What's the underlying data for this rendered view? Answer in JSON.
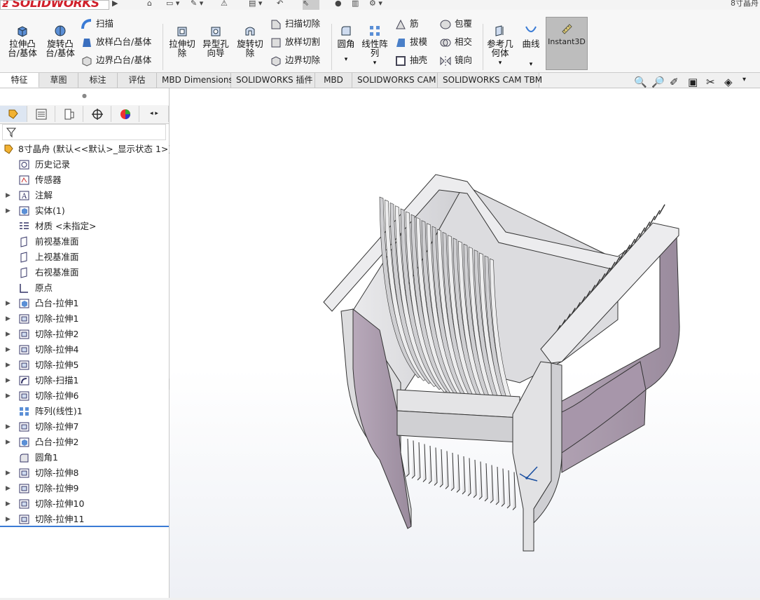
{
  "app": {
    "logo_text": "SOLIDWORKS",
    "title_fragment": "8寸晶舟"
  },
  "ribbon": {
    "buttons": [
      {
        "id": "extrude_boss",
        "label": "拉伸凸台/基体",
        "icon": "extrude-boss-icon"
      },
      {
        "id": "revolve_boss",
        "label": "旋转凸台/基体",
        "icon": "revolve-boss-icon"
      },
      {
        "id": "extrude_cut",
        "label": "拉伸切除",
        "icon": "extrude-cut-icon"
      },
      {
        "id": "hole_wizard",
        "label": "异型孔向导",
        "icon": "hole-wizard-icon"
      },
      {
        "id": "revolve_cut",
        "label": "旋转切除",
        "icon": "revolve-cut-icon"
      },
      {
        "id": "fillet",
        "label": "圆角",
        "icon": "fillet-icon"
      },
      {
        "id": "linear_pattern",
        "label": "线性阵列",
        "icon": "linear-pattern-icon"
      },
      {
        "id": "ref_geometry",
        "label": "参考几何体",
        "icon": "reference-geometry-icon"
      },
      {
        "id": "curves",
        "label": "曲线",
        "icon": "curves-icon"
      },
      {
        "id": "instant3d",
        "label": "Instant3D",
        "icon": "instant3d-icon"
      }
    ],
    "small": {
      "sweep": "扫描",
      "loft": "放样凸台/基体",
      "boundary": "边界凸台/基体",
      "sweep_cut": "扫描切除",
      "loft_cut": "放样切割",
      "boundary_cut": "边界切除",
      "rib": "筋",
      "draft": "拔模",
      "shell": "抽壳",
      "wrap": "包覆",
      "intersect": "相交",
      "mirror": "镜向"
    }
  },
  "tabs": [
    "特征",
    "草图",
    "标注",
    "评估",
    "MBD Dimensions",
    "SOLIDWORKS 插件",
    "MBD",
    "SOLIDWORKS CAM",
    "SOLIDWORKS CAM TBM"
  ],
  "active_tab": "特征",
  "tree": {
    "root": "8寸晶舟  (默认<<默认>_显示状态 1>)",
    "items": [
      {
        "label": "历史记录",
        "icon": "history-icon",
        "expand": false
      },
      {
        "label": "传感器",
        "icon": "sensor-icon",
        "expand": false
      },
      {
        "label": "注解",
        "icon": "annotation-icon",
        "expand": true
      },
      {
        "label": "实体(1)",
        "icon": "solid-bodies-icon",
        "expand": true
      },
      {
        "label": "材质 <未指定>",
        "icon": "material-icon",
        "expand": false
      },
      {
        "label": "前视基准面",
        "icon": "plane-icon",
        "expand": false
      },
      {
        "label": "上视基准面",
        "icon": "plane-icon",
        "expand": false
      },
      {
        "label": "右视基准面",
        "icon": "plane-icon",
        "expand": false
      },
      {
        "label": "原点",
        "icon": "origin-icon",
        "expand": false
      },
      {
        "label": "凸台-拉伸1",
        "icon": "boss-extrude-icon",
        "expand": true
      },
      {
        "label": "切除-拉伸1",
        "icon": "cut-extrude-icon",
        "expand": true
      },
      {
        "label": "切除-拉伸2",
        "icon": "cut-extrude-icon",
        "expand": true
      },
      {
        "label": "切除-拉伸4",
        "icon": "cut-extrude-icon",
        "expand": true
      },
      {
        "label": "切除-拉伸5",
        "icon": "cut-extrude-icon",
        "expand": true
      },
      {
        "label": "切除-扫描1",
        "icon": "cut-sweep-icon",
        "expand": true
      },
      {
        "label": "切除-拉伸6",
        "icon": "cut-extrude-icon",
        "expand": true
      },
      {
        "label": "阵列(线性)1",
        "icon": "linear-pattern-icon",
        "expand": false
      },
      {
        "label": "切除-拉伸7",
        "icon": "cut-extrude-icon",
        "expand": true
      },
      {
        "label": "凸台-拉伸2",
        "icon": "boss-extrude-icon",
        "expand": true
      },
      {
        "label": "圆角1",
        "icon": "fillet-icon",
        "expand": false
      },
      {
        "label": "切除-拉伸8",
        "icon": "cut-extrude-icon",
        "expand": true
      },
      {
        "label": "切除-拉伸9",
        "icon": "cut-extrude-icon",
        "expand": true
      },
      {
        "label": "切除-拉伸10",
        "icon": "cut-extrude-icon",
        "expand": true
      },
      {
        "label": "切除-拉伸11",
        "icon": "cut-extrude-icon",
        "expand": true
      }
    ]
  },
  "colors": {
    "model_face": "#a595a8",
    "model_light": "#e1e1e4",
    "model_edge": "#2a2a2a",
    "accent_blue": "#1a4fa0"
  }
}
